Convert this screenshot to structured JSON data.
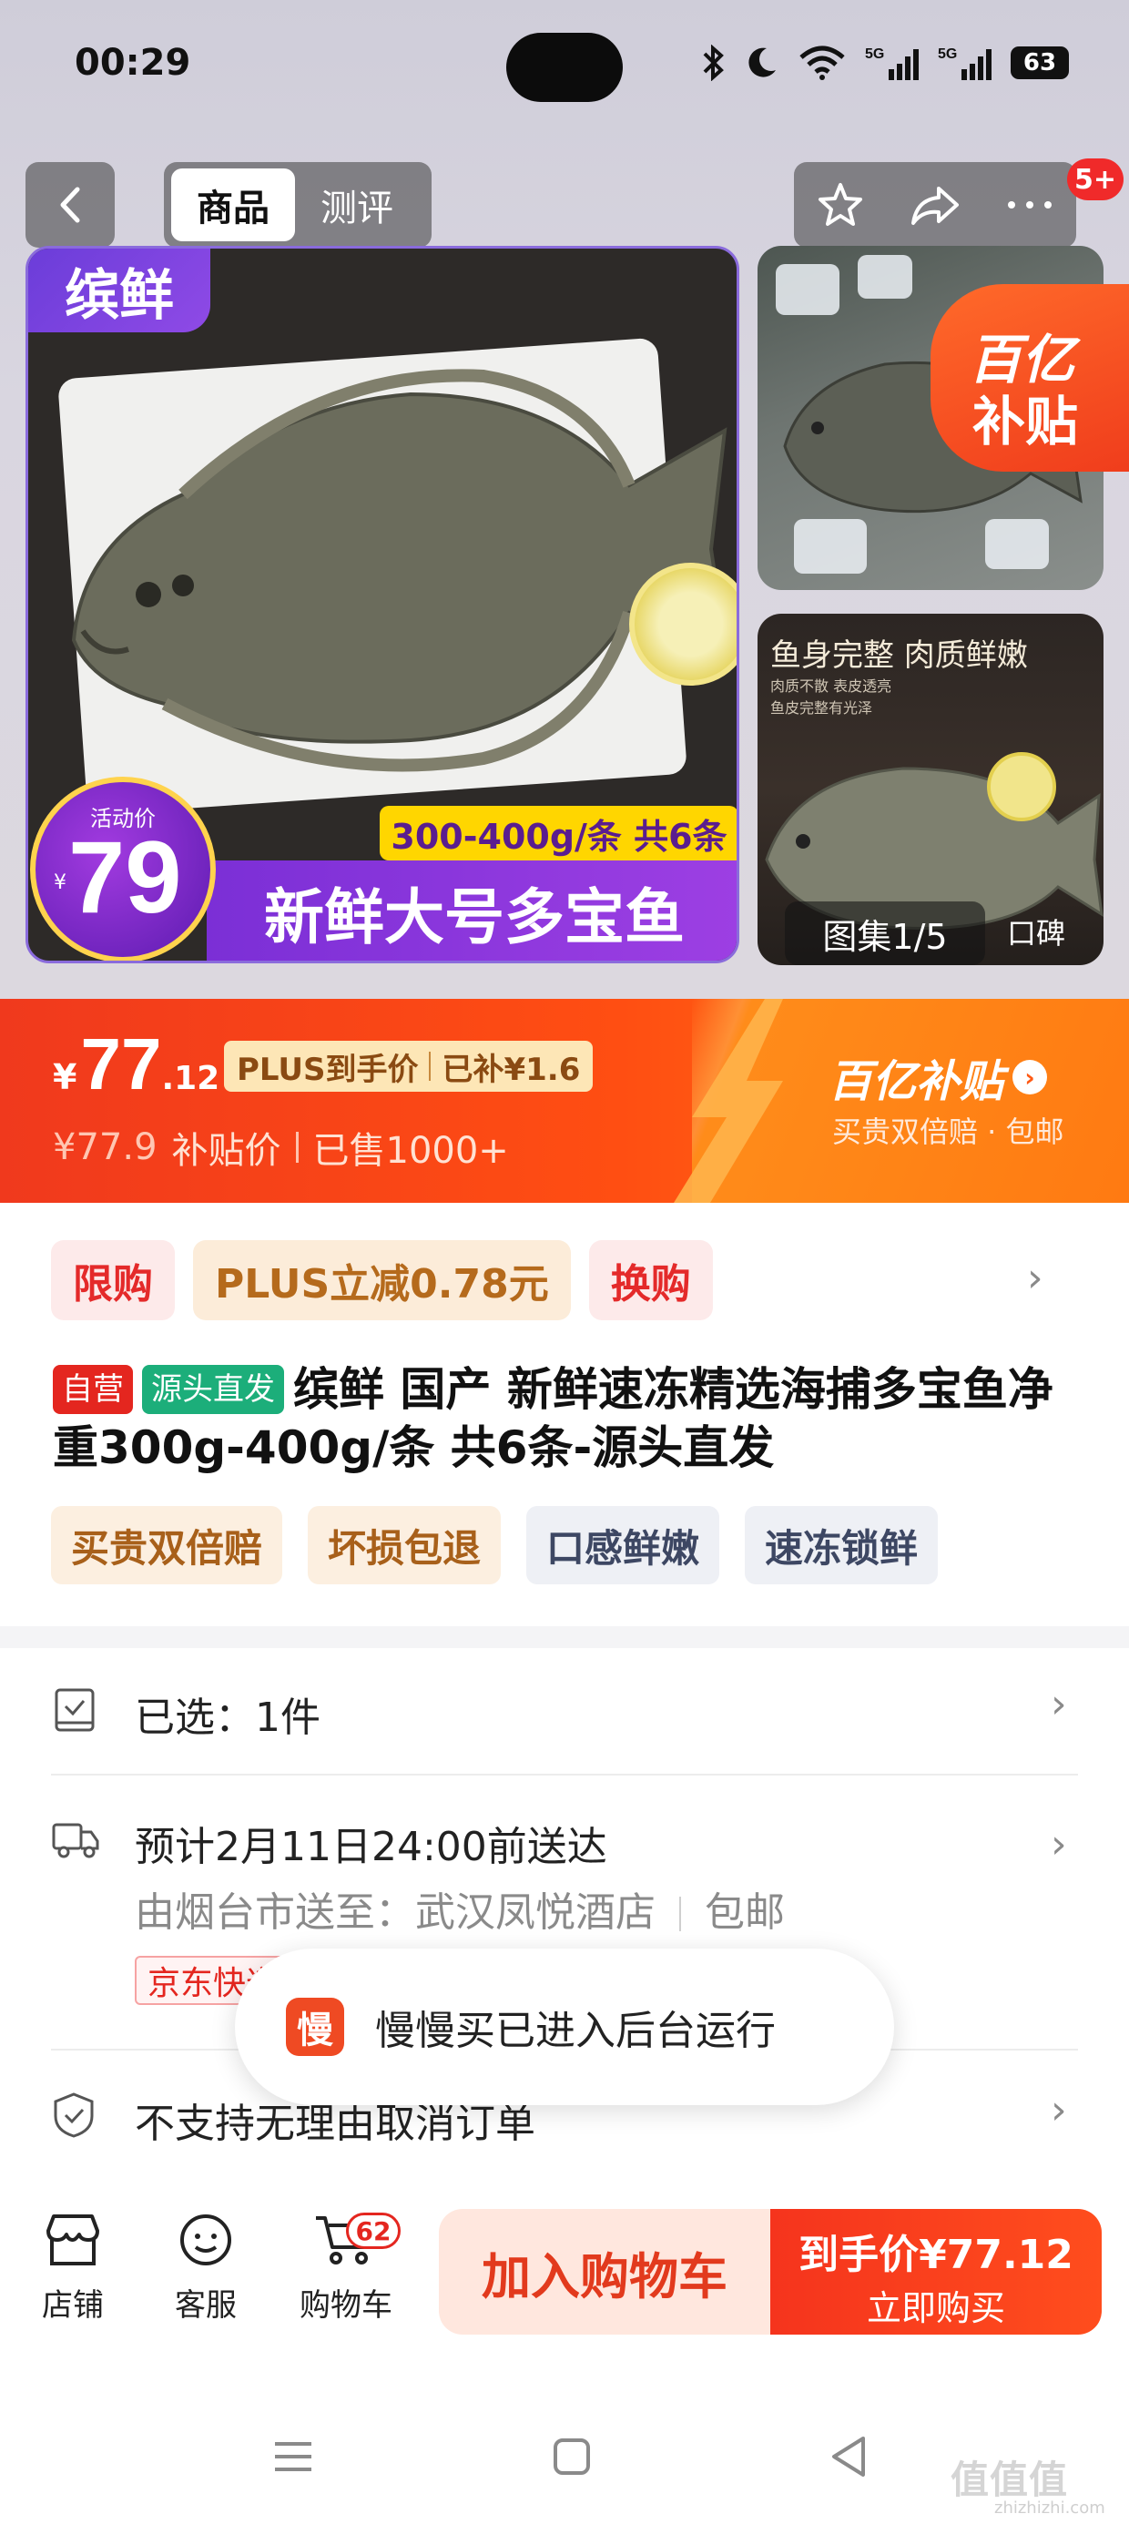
{
  "status_bar": {
    "time": "00:29",
    "battery": "63",
    "signal1": "5G",
    "signal2": "5G"
  },
  "top_nav": {
    "tabs": [
      {
        "label": "商品",
        "active": true
      },
      {
        "label": "测评",
        "active": false
      }
    ],
    "badge": "5+",
    "icons": [
      "back-icon",
      "star-icon",
      "share-icon",
      "more-icon"
    ]
  },
  "gallery": {
    "brand_tag": "缤鲜",
    "activity_label": "活动价",
    "activity_currency": "¥",
    "activity_price": "79",
    "spec_banner": "300-400g/条 共6条",
    "name_banner": "新鲜大号多宝鱼",
    "subsidy_badge_line1": "百亿",
    "subsidy_badge_line2": "补贴",
    "thumb2_title": "鱼身完整 肉质鲜嫩",
    "thumb2_sub1": "肉质不散 表皮透亮",
    "thumb2_sub2": "鱼皮完整有光泽",
    "counter": "图集1/5",
    "reviews": "口碑"
  },
  "price_strip": {
    "currency": "¥",
    "price_int": "77",
    "price_dec": ".12",
    "plus_label": "PLUS到手价",
    "plus_saving": "已补¥1.6",
    "original_price": "¥77.9",
    "subsidy_price_label": "补贴价",
    "sold": "已售1000+",
    "brand": "百亿补贴",
    "brand_desc": "买贵双倍赔 · 包邮",
    "accent_color": "#f0391d"
  },
  "promo_tags": [
    "限购",
    "PLUS立减0.78元",
    "换购"
  ],
  "product": {
    "tag_self": "自营",
    "tag_source": "源头直发",
    "title": "缤鲜 国产 新鲜速冻精选海捕多宝鱼净重300g-400g/条 共6条-源头直发"
  },
  "features": [
    "买贵双倍赔",
    "坏损包退",
    "口感鲜嫩",
    "速冻锁鲜"
  ],
  "selection": {
    "label": "已选：1件"
  },
  "delivery": {
    "eta": "预计2月11日24:00前送达",
    "route": "由烟台市送至：武汉凤悦酒店",
    "shipping": "包邮",
    "tag": "京东快递"
  },
  "refund": {
    "label": "不支持无理由取消订单"
  },
  "toast": {
    "icon": "慢",
    "text": "慢慢买已进入后台运行"
  },
  "bottom_bar": {
    "store": "店铺",
    "service": "客服",
    "cart": "购物车",
    "cart_count": "62",
    "add_to_cart": "加入购物车",
    "buy_price_label": "到手价¥77.12",
    "buy_now": "立即购买"
  },
  "watermark": {
    "main": "值值值",
    "sub": "zhizhizhi.com"
  }
}
